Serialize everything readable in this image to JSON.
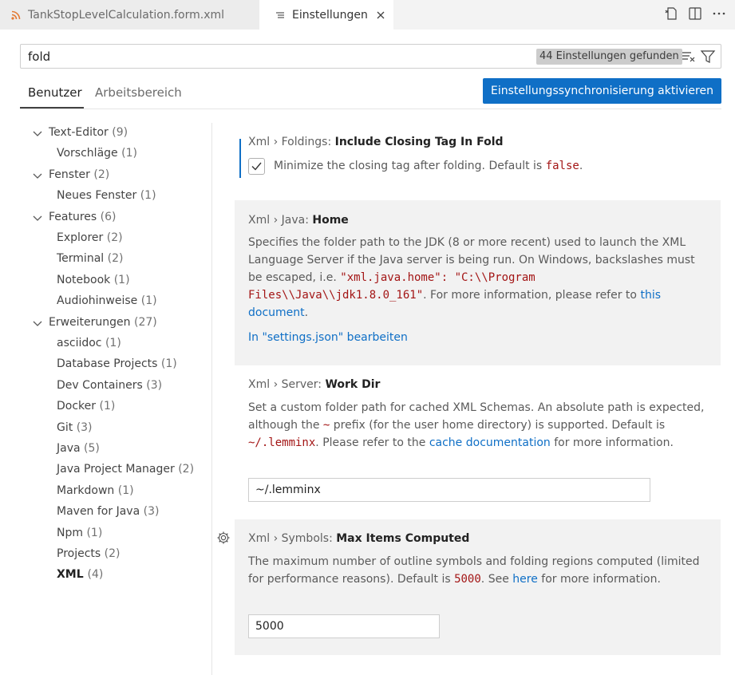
{
  "tabs": [
    {
      "label": "TankStopLevelCalculation.form.xml",
      "icon": "rss-icon"
    },
    {
      "label": "Einstellungen",
      "icon": "preferences-icon"
    }
  ],
  "search": {
    "value": "fold",
    "result_count": "44 Einstellungen gefunden"
  },
  "scopes": {
    "user": "Benutzer",
    "workspace": "Arbeitsbereich"
  },
  "sync_button": "Einstellungssynchronisierung aktivieren",
  "toc": [
    {
      "label": "Text-Editor",
      "count": "(9)",
      "level": 0
    },
    {
      "label": "Vorschläge",
      "count": "(1)",
      "level": 1
    },
    {
      "label": "Fenster",
      "count": "(2)",
      "level": 0
    },
    {
      "label": "Neues Fenster",
      "count": "(1)",
      "level": 1
    },
    {
      "label": "Features",
      "count": "(6)",
      "level": 0
    },
    {
      "label": "Explorer",
      "count": "(2)",
      "level": 1
    },
    {
      "label": "Terminal",
      "count": "(2)",
      "level": 1
    },
    {
      "label": "Notebook",
      "count": "(1)",
      "level": 1
    },
    {
      "label": "Audiohinweise",
      "count": "(1)",
      "level": 1
    },
    {
      "label": "Erweiterungen",
      "count": "(27)",
      "level": 0
    },
    {
      "label": "asciidoc",
      "count": "(1)",
      "level": 1
    },
    {
      "label": "Database Projects",
      "count": "(1)",
      "level": 1
    },
    {
      "label": "Dev Containers",
      "count": "(3)",
      "level": 1
    },
    {
      "label": "Docker",
      "count": "(1)",
      "level": 1
    },
    {
      "label": "Git",
      "count": "(3)",
      "level": 1
    },
    {
      "label": "Java",
      "count": "(5)",
      "level": 1
    },
    {
      "label": "Java Project Manager",
      "count": "(2)",
      "level": 1
    },
    {
      "label": "Markdown",
      "count": "(1)",
      "level": 1
    },
    {
      "label": "Maven for Java",
      "count": "(3)",
      "level": 1
    },
    {
      "label": "Npm",
      "count": "(1)",
      "level": 1
    },
    {
      "label": "Projects",
      "count": "(2)",
      "level": 1
    },
    {
      "label": "XML",
      "count": "(4)",
      "level": 1,
      "selected": true
    }
  ],
  "settings": {
    "folding": {
      "category": "Xml › Foldings: ",
      "name": "Include Closing Tag In Fold",
      "desc": "Minimize the closing tag after folding. Default is ",
      "default": "false",
      "desc_end": ".",
      "checked": true
    },
    "java_home": {
      "category": "Xml › Java: ",
      "name": "Home",
      "desc1": "Specifies the folder path to the JDK (8 or more recent) used to launch the XML Language Server if the Java server is being run. On Windows, backslashes must be escaped, i.e. ",
      "code": "\"xml.java.home\": \"C:\\\\Program Files\\\\Java\\\\jdk1.8.0_161\"",
      "desc2": ". For more information, please refer to ",
      "link": "this document",
      "desc3": ".",
      "edit_link": "In \"settings.json\" bearbeiten"
    },
    "workdir": {
      "category": "Xml › Server: ",
      "name": "Work Dir",
      "desc1": "Set a custom folder path for cached XML Schemas. An absolute path is expected, although the ",
      "tilde": "~",
      "desc2": " prefix (for the user home directory) is supported. Default is ",
      "default": "~/.lemminx",
      "desc3": ". Please refer to the ",
      "link": "cache documentation",
      "desc4": " for more information.",
      "value": "~/.lemminx"
    },
    "symbols": {
      "category": "Xml › Symbols: ",
      "name": "Max Items Computed",
      "desc1": "The maximum number of outline symbols and folding regions computed (limited for performance reasons). Default is ",
      "default": "5000",
      "desc2": ". See ",
      "link": "here",
      "desc3": " for more information.",
      "value": "5000"
    }
  }
}
